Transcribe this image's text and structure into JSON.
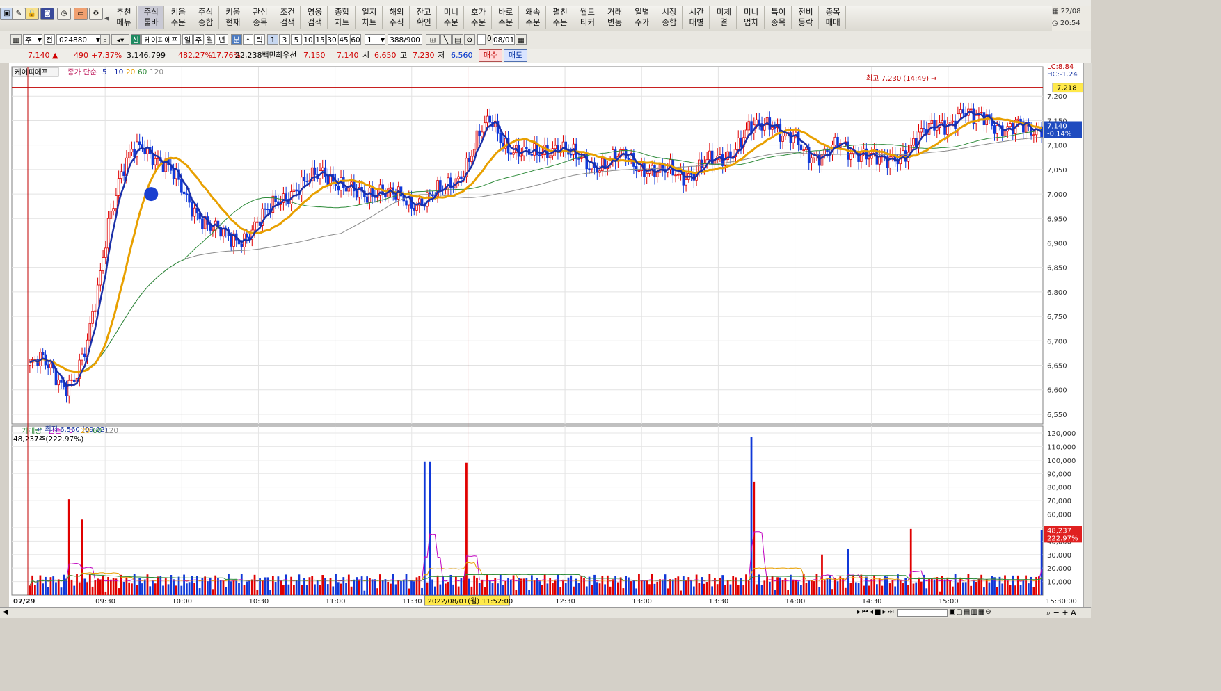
{
  "toolbar": {
    "menu_buttons": [
      {
        "l1": "추천",
        "l2": "메뉴"
      },
      {
        "l1": "주식",
        "l2": "툴바"
      },
      {
        "l1": "키움",
        "l2": "주문"
      },
      {
        "l1": "주식",
        "l2": "종합"
      },
      {
        "l1": "키움",
        "l2": "현재"
      },
      {
        "l1": "관심",
        "l2": "종목"
      },
      {
        "l1": "조건",
        "l2": "검색"
      },
      {
        "l1": "영웅",
        "l2": "검색"
      },
      {
        "l1": "종합",
        "l2": "차트"
      },
      {
        "l1": "일지",
        "l2": "차트"
      },
      {
        "l1": "해외",
        "l2": "주식"
      },
      {
        "l1": "잔고",
        "l2": "확인"
      },
      {
        "l1": "미니",
        "l2": "주문"
      },
      {
        "l1": "호가",
        "l2": "주문"
      },
      {
        "l1": "바로",
        "l2": "주문"
      },
      {
        "l1": "왜속",
        "l2": "주문"
      },
      {
        "l1": "펼친",
        "l2": "주문"
      },
      {
        "l1": "월드",
        "l2": "티커"
      },
      {
        "l1": "거래",
        "l2": "변동"
      },
      {
        "l1": "일별",
        "l2": "주가"
      },
      {
        "l1": "시장",
        "l2": "종합"
      },
      {
        "l1": "시간",
        "l2": "대별"
      },
      {
        "l1": "미체",
        "l2": "결"
      },
      {
        "l1": "미니",
        "l2": "업차"
      },
      {
        "l1": "특이",
        "l2": "종목"
      },
      {
        "l1": "전비",
        "l2": "등락"
      },
      {
        "l1": "종목",
        "l2": "매매"
      }
    ],
    "date": "22/08",
    "time": "20:54"
  },
  "search": {
    "market": "주",
    "range": "전",
    "code": "024880",
    "credit_badge": "신",
    "stock_name": "케이피에프",
    "periods": [
      "일",
      "주",
      "월",
      "년",
      "분",
      "초",
      "틱"
    ],
    "minute_options": [
      "1",
      "3",
      "5",
      "10",
      "15",
      "30",
      "45",
      "60"
    ],
    "unit_value": "1",
    "count": "388/900",
    "checkbox_value": "0",
    "date": "08/01"
  },
  "pricebar": {
    "price": "7,140",
    "change": "490",
    "change_pct": "+7.37%",
    "volume": "3,146,799",
    "vol_ratio": "482.27%",
    "turnover": "17.76%",
    "amount": "22,238백만",
    "best_label": "최우선",
    "best_ask": "7,150",
    "best_bid": "7,140",
    "open_label": "시",
    "open": "6,650",
    "high_label": "고",
    "high": "7,230",
    "low_label": "저",
    "low": "6,560",
    "buy_button": "매수",
    "sell_button": "매도"
  },
  "chart_data": [
    {
      "type": "candlestick",
      "title": "케이피에프",
      "legend": {
        "label": "종가 단순",
        "periods": [
          "5",
          "10",
          "20",
          "60",
          "120"
        ],
        "colors": [
          "#1a2fa8",
          "#1a2fa8",
          "#e8a000",
          "#2e8b3a",
          "#8a8a8a"
        ]
      },
      "x_ticks": [
        "07/29",
        "09:30",
        "10:00",
        "10:30",
        "11:00",
        "11:30",
        "12:30",
        "13:00",
        "13:30",
        "14:00",
        "14:30",
        "15:00",
        "15:30:00"
      ],
      "ylim": [
        6530,
        7260
      ],
      "y_ticks": [
        "7,200",
        "7,150",
        "7,100",
        "7,050",
        "7,000",
        "6,950",
        "6,900",
        "6,850",
        "6,800",
        "6,750",
        "6,700",
        "6,650",
        "6,600",
        "6,550"
      ],
      "price_series_shape": [
        6650,
        6660,
        6640,
        6610,
        6620,
        6680,
        6800,
        6950,
        7030,
        7080,
        7100,
        7080,
        7060,
        7030,
        6990,
        6960,
        6930,
        6920,
        6910,
        6910,
        6930,
        6960,
        6990,
        7000,
        7010,
        7030,
        7050,
        7030,
        7010,
        7000,
        7000,
        7010,
        7000,
        6990,
        6980,
        6990,
        7000,
        7010,
        7030,
        7070,
        7120,
        7150,
        7110,
        7090,
        7080,
        7080,
        7090,
        7100,
        7080,
        7070,
        7060,
        7060,
        7070,
        7080,
        7060,
        7050,
        7040,
        7050,
        7040,
        7040,
        7060,
        7070,
        7080,
        7100,
        7130,
        7140,
        7150,
        7120,
        7110,
        7080,
        7080,
        7090,
        7100,
        7080,
        7090,
        7080,
        7060,
        7070,
        7090,
        7120,
        7130,
        7140,
        7150,
        7170,
        7150,
        7160,
        7140,
        7130,
        7140,
        7130,
        7140
      ],
      "annotations": {
        "high": "최고 7,230 (14:49)",
        "low": "최저 6,560 (09:02)",
        "last_price": "7,140",
        "last_change": "-0.14%",
        "crosshair_price": "7,218",
        "lc": "LC:8.84",
        "hc": "HC:-1.24",
        "crosshair_time": "2022/08/01(월) 11:52:00"
      }
    },
    {
      "type": "bar",
      "title": "거래량",
      "legend": {
        "label": "단순",
        "periods": [
          "5",
          "20",
          "60",
          "120"
        ],
        "colors": [
          "#c000c0",
          "#e8a000",
          "#2e8b3a",
          "#8a8a8a"
        ]
      },
      "current": "48,237주(222.97%)",
      "ylim": [
        0,
        120000
      ],
      "y_ticks": [
        "120,000",
        "110,000",
        "100,000",
        "90,000",
        "80,000",
        "70,000",
        "60,000",
        "50,000",
        "40,000",
        "30,000",
        "20,000",
        "10,000"
      ],
      "last_volume": "48,237",
      "last_pct": "222.97%",
      "volume_spikes": [
        {
          "time": "09:15",
          "value": 71000
        },
        {
          "time": "09:20",
          "value": 56000
        },
        {
          "time": "11:32",
          "value": 99000
        },
        {
          "time": "11:34",
          "value": 99000
        },
        {
          "time": "11:48",
          "value": 98000
        },
        {
          "time": "13:38",
          "value": 117000
        },
        {
          "time": "13:39",
          "value": 84000
        },
        {
          "time": "14:05",
          "value": 30000
        },
        {
          "time": "14:15",
          "value": 34000
        },
        {
          "time": "14:40",
          "value": 49000
        },
        {
          "time": "15:30",
          "value": 48237
        }
      ]
    }
  ]
}
